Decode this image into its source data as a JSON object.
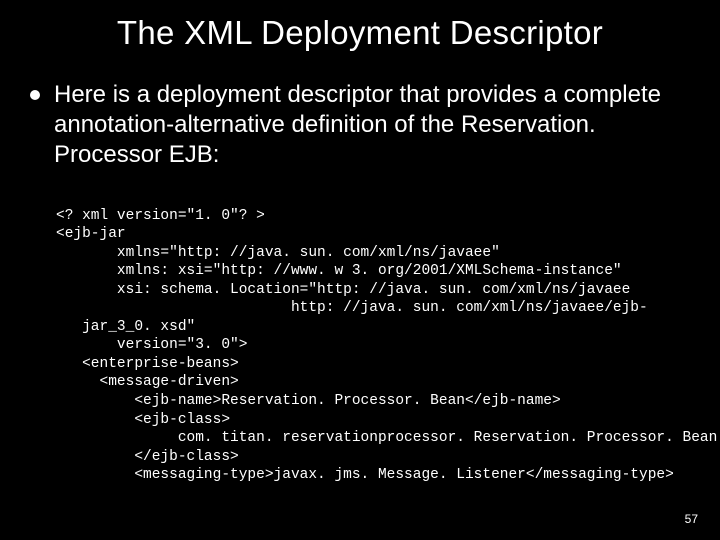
{
  "slide": {
    "title": "The XML Deployment Descriptor",
    "bullet": "Here is a deployment descriptor that provides a complete annotation-alternative definition of the Reservation. Processor EJB:",
    "code_lines": [
      "<? xml version=\"1. 0\"? >",
      "<ejb-jar",
      "       xmlns=\"http: //java. sun. com/xml/ns/javaee\"",
      "       xmlns: xsi=\"http: //www. w 3. org/2001/XMLSchema-instance\"",
      "       xsi: schema. Location=\"http: //java. sun. com/xml/ns/javaee",
      "                           http: //java. sun. com/xml/ns/javaee/ejb-",
      "   jar_3_0. xsd\"",
      "       version=\"3. 0\">",
      "   <enterprise-beans>",
      "     <message-driven>",
      "         <ejb-name>Reservation. Processor. Bean</ejb-name>",
      "         <ejb-class>",
      "              com. titan. reservationprocessor. Reservation. Processor. Bean",
      "         </ejb-class>",
      "         <messaging-type>javax. jms. Message. Listener</messaging-type>"
    ],
    "page_number": "57"
  }
}
